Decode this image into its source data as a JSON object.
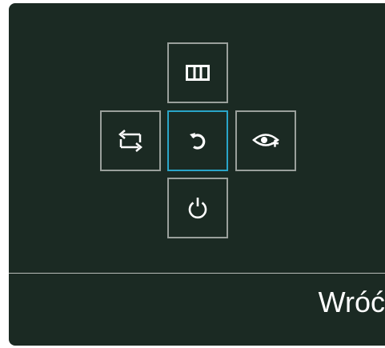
{
  "osd": {
    "selected_action_label": "Wróć",
    "buttons": {
      "top": "columns-icon",
      "left": "source-switch-icon",
      "center": "return-icon",
      "right": "eye-saver-icon",
      "bottom": "power-icon"
    },
    "colors": {
      "background": "#1b2a23",
      "border": "#9aa09c",
      "active_border": "#2aa5c9",
      "icon": "#ffffff"
    }
  }
}
